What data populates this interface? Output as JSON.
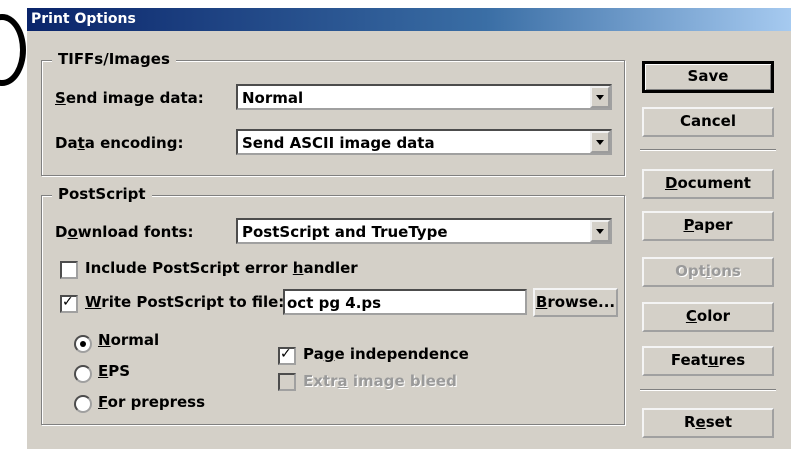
{
  "window": {
    "title": "Print Options"
  },
  "tiffs_group": {
    "legend": "TIFFs/Images",
    "send_image_label": "Send image data:",
    "send_image_value": "Normal",
    "data_encoding_label": "Data encoding:",
    "data_encoding_value": "Send ASCII image data"
  },
  "postscript_group": {
    "legend": "PostScript",
    "download_fonts_label": "Download fonts:",
    "download_fonts_value": "PostScript and TrueType",
    "include_error_handler_label": "Include PostScript error handler",
    "include_error_handler_checked": false,
    "write_to_file_label": "Write PostScript to file:",
    "write_to_file_checked": true,
    "file_name": "oct pg 4.ps",
    "browse_label": "Browse...",
    "output_options": [
      "Normal",
      "EPS",
      "For prepress"
    ],
    "selected_output": "Normal",
    "page_independence_label": "Page independence",
    "page_independence_checked": true,
    "extra_bleed_label": "Extra image bleed",
    "extra_bleed_checked": false
  },
  "buttons": {
    "save": "Save",
    "cancel": "Cancel",
    "document": "Document",
    "paper": "Paper",
    "options": "Options",
    "color": "Color",
    "features": "Features",
    "reset": "Reset"
  }
}
